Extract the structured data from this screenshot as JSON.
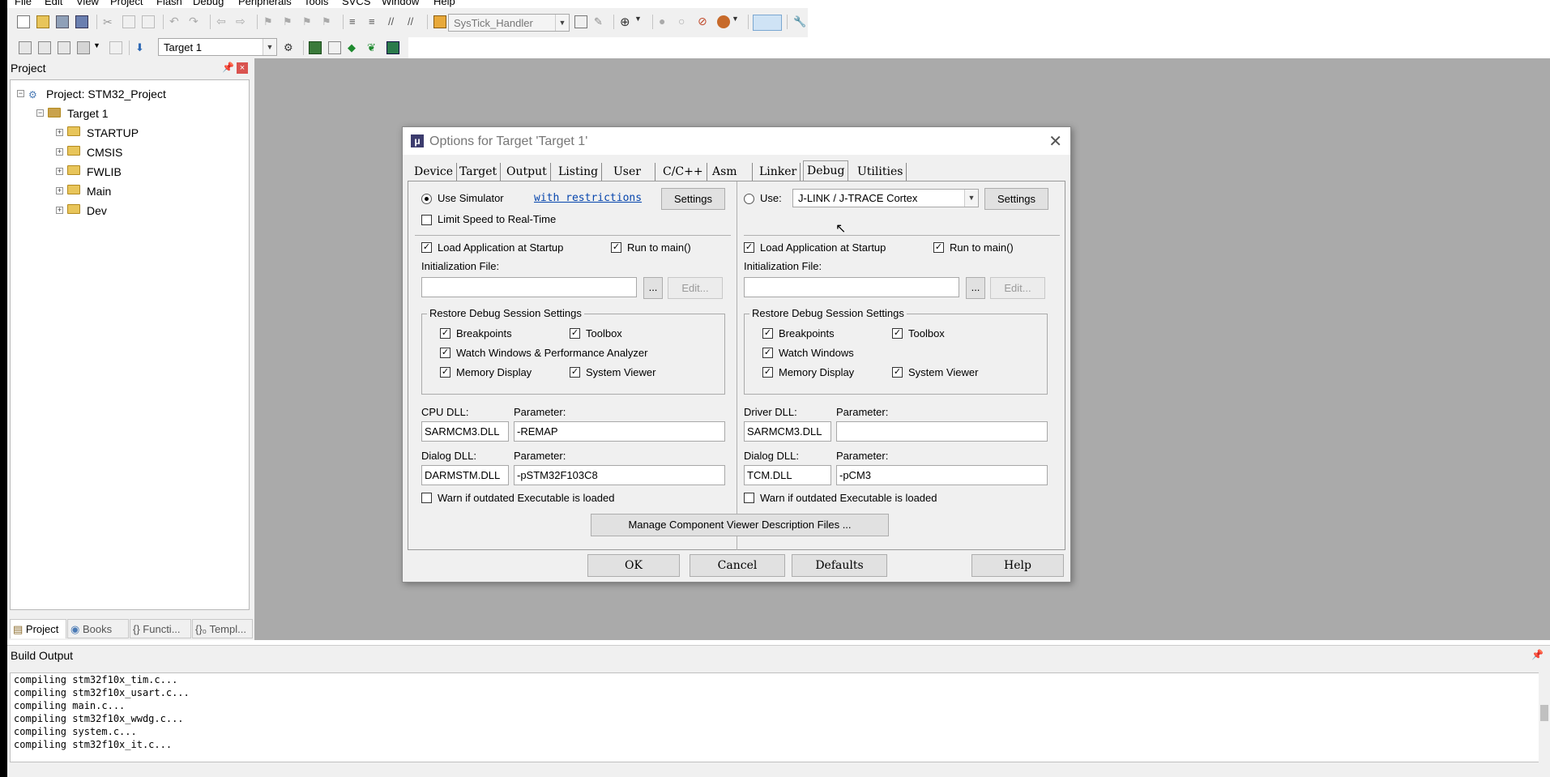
{
  "menubar": {
    "items": [
      "File",
      "Edit",
      "View",
      "Project",
      "Flash",
      "Debug",
      "Peripherals",
      "Tools",
      "SVCS",
      "Window",
      "Help"
    ]
  },
  "toolbar": {
    "function_combo": "SysTick_Handler",
    "target_combo": "Target 1"
  },
  "project_panel": {
    "title": "Project",
    "root": "Project: STM32_Project",
    "target": "Target 1",
    "groups": [
      "STARTUP",
      "CMSIS",
      "FWLIB",
      "Main",
      "Dev"
    ],
    "tabs": [
      "Project",
      "Books",
      "{} Functi...",
      "{}₀ Templ..."
    ]
  },
  "dialog": {
    "title": "Options for Target 'Target 1'",
    "tabs": [
      "Device",
      "Target",
      "Output",
      "Listing",
      "User",
      "C/C++",
      "Asm",
      "Linker",
      "Debug",
      "Utilities"
    ],
    "active_tab": "Debug",
    "left": {
      "use_simulator": "Use Simulator",
      "restrictions_link": "with restrictions",
      "settings": "Settings",
      "limit_speed": "Limit Speed to Real-Time",
      "load_app": "Load Application at Startup",
      "run_to_main": "Run to main()",
      "init_file_label": "Initialization File:",
      "init_file_value": "",
      "browse": "...",
      "edit": "Edit...",
      "restore_group": "Restore Debug Session Settings",
      "breakpoints": "Breakpoints",
      "toolbox": "Toolbox",
      "watch_windows": "Watch Windows & Performance Analyzer",
      "memory_display": "Memory Display",
      "system_viewer": "System Viewer",
      "cpu_dll_label": "CPU DLL:",
      "cpu_dll": "SARMCM3.DLL",
      "param_label": "Parameter:",
      "cpu_param": "-REMAP",
      "dialog_dll_label": "Dialog DLL:",
      "dialog_dll": "DARMSTM.DLL",
      "dialog_param": "-pSTM32F103C8",
      "warn": "Warn if outdated Executable is loaded"
    },
    "right": {
      "use": "Use:",
      "driver": "J-LINK / J-TRACE Cortex",
      "settings": "Settings",
      "load_app": "Load Application at Startup",
      "run_to_main": "Run to main()",
      "init_file_label": "Initialization File:",
      "init_file_value": "",
      "browse": "...",
      "edit": "Edit...",
      "restore_group": "Restore Debug Session Settings",
      "breakpoints": "Breakpoints",
      "toolbox": "Toolbox",
      "watch_windows": "Watch Windows",
      "memory_display": "Memory Display",
      "system_viewer": "System Viewer",
      "driver_dll_label": "Driver DLL:",
      "driver_dll": "SARMCM3.DLL",
      "param_label": "Parameter:",
      "driver_param": "",
      "dialog_dll_label": "Dialog DLL:",
      "dialog_dll": "TCM.DLL",
      "dialog_param": "-pCM3",
      "warn": "Warn if outdated Executable is loaded"
    },
    "manage_button": "Manage Component Viewer Description Files ...",
    "buttons": {
      "ok": "OK",
      "cancel": "Cancel",
      "defaults": "Defaults",
      "help": "Help"
    }
  },
  "build_output": {
    "title": "Build Output",
    "lines": [
      "compiling stm32f10x_tim.c...",
      "compiling stm32f10x_usart.c...",
      "compiling main.c...",
      "compiling stm32f10x_wwdg.c...",
      "compiling system.c...",
      "compiling stm32f10x_it.c..."
    ]
  }
}
